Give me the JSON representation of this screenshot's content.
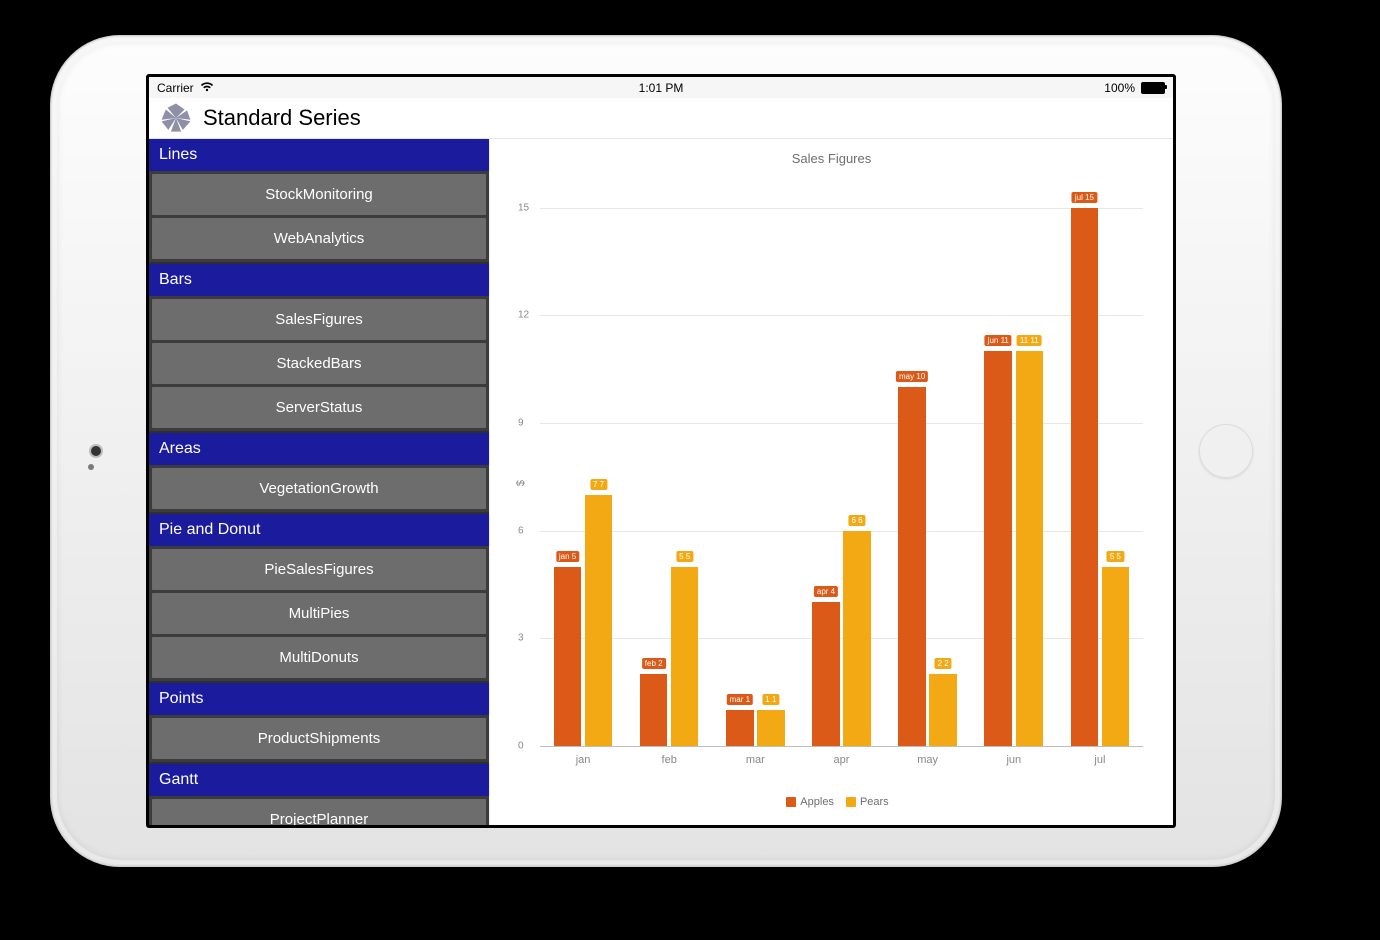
{
  "statusbar": {
    "carrier": "Carrier",
    "time": "1:01 PM",
    "battery": "100%"
  },
  "titlebar": {
    "title": "Standard Series"
  },
  "sidebar": {
    "sections": [
      {
        "header": "Lines",
        "items": [
          "StockMonitoring",
          "WebAnalytics"
        ]
      },
      {
        "header": "Bars",
        "items": [
          "SalesFigures",
          "StackedBars",
          "ServerStatus"
        ]
      },
      {
        "header": "Areas",
        "items": [
          "VegetationGrowth"
        ]
      },
      {
        "header": "Pie and Donut",
        "items": [
          "PieSalesFigures",
          "MultiPies",
          "MultiDonuts"
        ]
      },
      {
        "header": "Points",
        "items": [
          "ProductShipments"
        ]
      },
      {
        "header": "Gantt",
        "items": [
          "ProjectPlanner"
        ]
      }
    ]
  },
  "chart_data": {
    "type": "bar",
    "title": "Sales Figures",
    "ylabel": "$",
    "xlabel": "",
    "yticks": [
      0,
      3,
      6,
      9,
      12,
      15
    ],
    "ylim": [
      0,
      15.8
    ],
    "categories": [
      "jan",
      "feb",
      "mar",
      "apr",
      "may",
      "jun",
      "jul"
    ],
    "series": [
      {
        "name": "Apples",
        "color": "#dc5a17",
        "values": [
          5,
          2,
          1,
          4,
          10,
          11,
          15
        ],
        "labels": [
          "jan 5",
          "feb 2",
          "mar 1",
          "apr 4",
          "may 10",
          "jun 11",
          "jul 15"
        ]
      },
      {
        "name": "Pears",
        "color": "#f2a913",
        "values": [
          7,
          5,
          1,
          6,
          2,
          11,
          5
        ],
        "labels": [
          "7 7",
          "5 5",
          "1 1",
          "6 6",
          "2 2",
          "11 11",
          "5 5"
        ]
      }
    ],
    "legend": [
      "Apples",
      "Pears"
    ]
  }
}
